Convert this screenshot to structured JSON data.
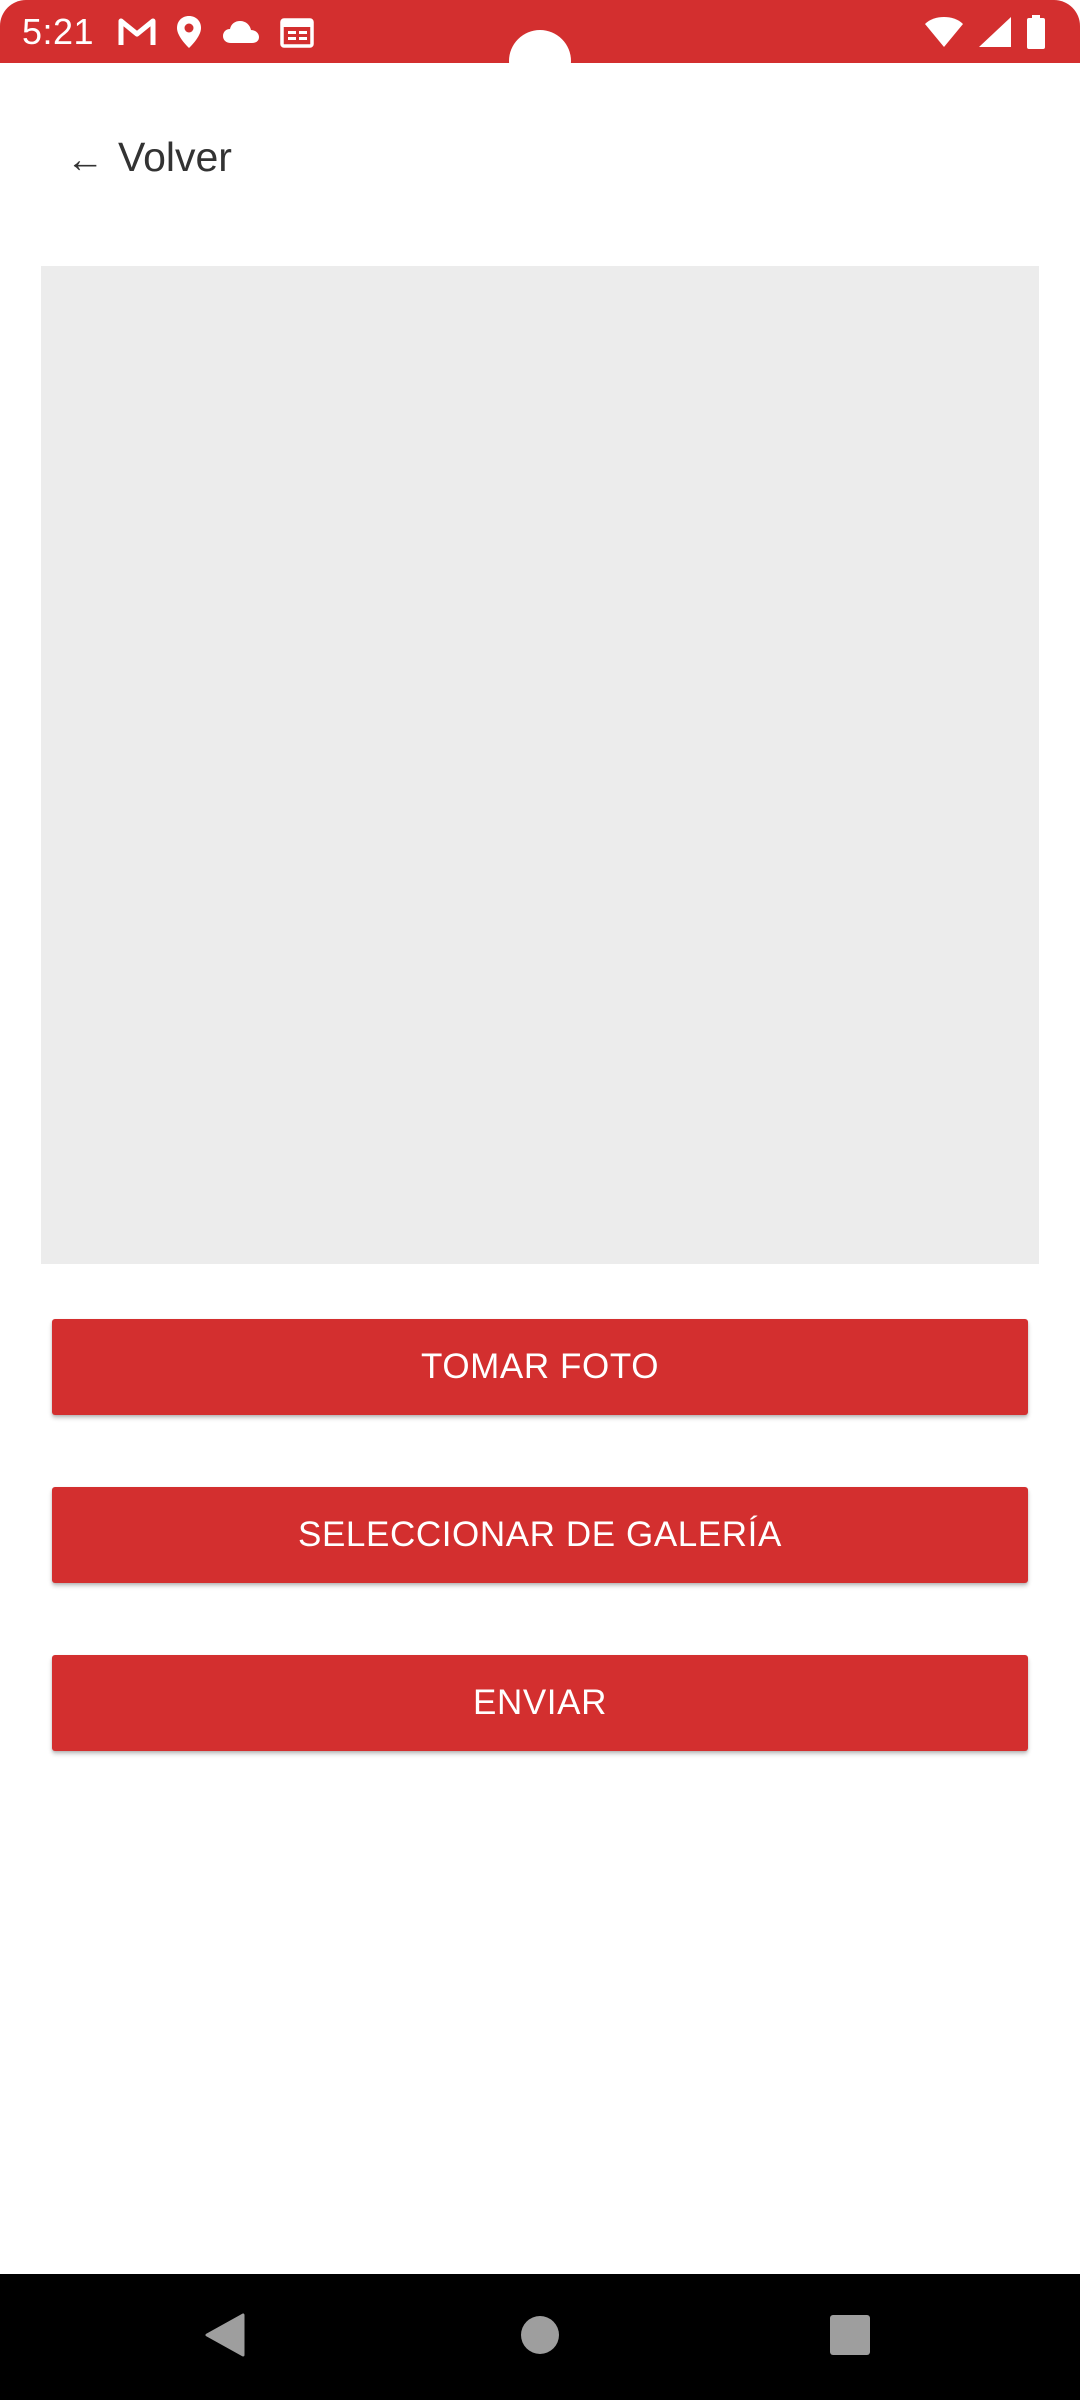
{
  "status_bar": {
    "time": "5:21",
    "left_icons": [
      "gmail-icon",
      "location-pin-icon",
      "cloud-icon",
      "calendar-icon"
    ],
    "right_icons": [
      "wifi-icon",
      "cellular-signal-icon",
      "battery-icon"
    ],
    "background_color": "#d32f2f"
  },
  "header": {
    "back_arrow": "←",
    "back_label": "Volver"
  },
  "preview": {
    "background_color": "#ececec"
  },
  "actions": {
    "take_photo_label": "TOMAR FOTO",
    "select_gallery_label": "SELECCIONAR DE GALERÍA",
    "send_label": "ENVIAR",
    "button_color": "#d32f2f"
  },
  "navigation_bar": {
    "icons": [
      "back-triangle-icon",
      "home-circle-icon",
      "recents-square-icon"
    ]
  }
}
